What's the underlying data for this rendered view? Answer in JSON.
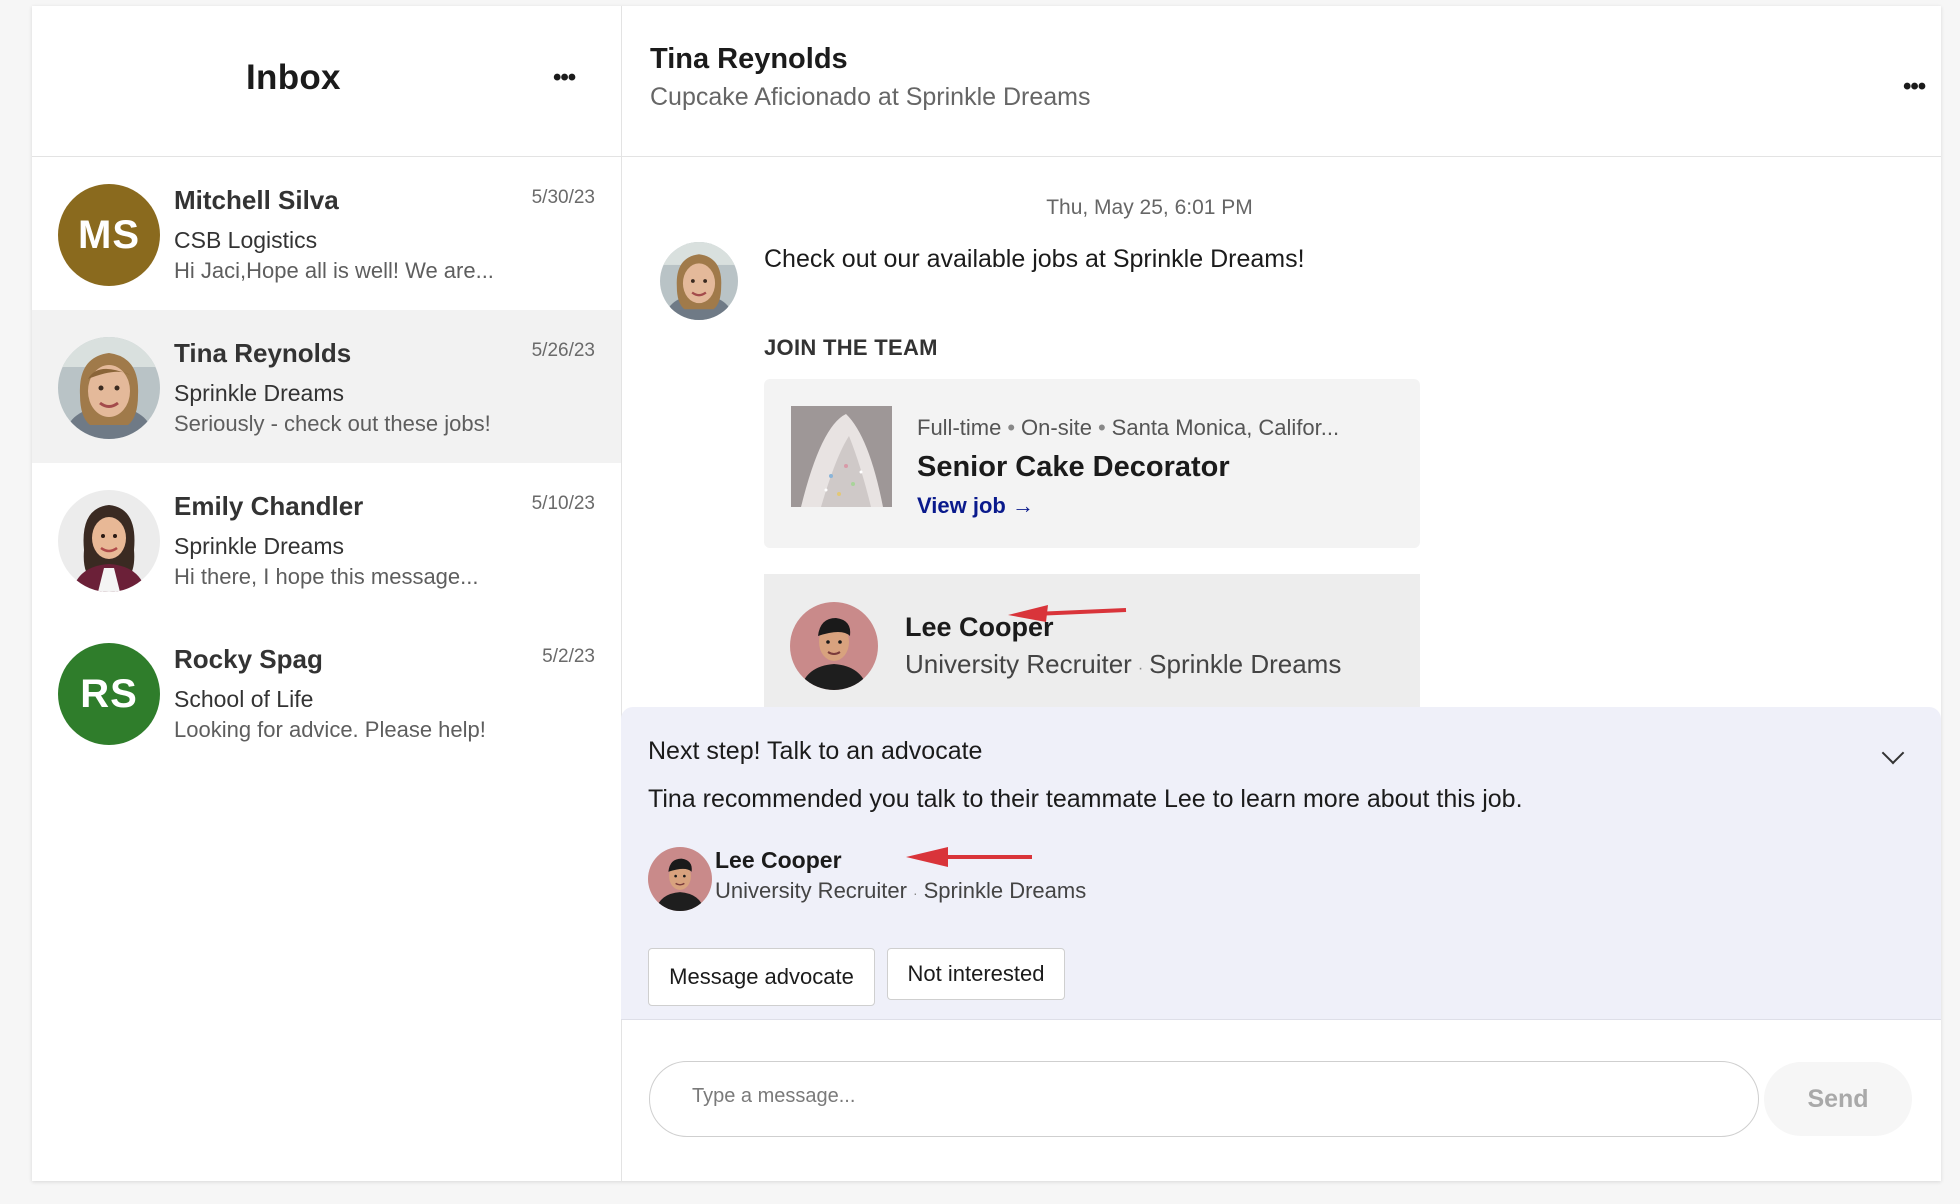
{
  "sidebar": {
    "title": "Inbox",
    "more_icon": "more-icon",
    "conversations": [
      {
        "name": "Mitchell Silva",
        "company": "CSB Logistics",
        "preview": "Hi Jaci,Hope all is well!  We are...",
        "date": "5/30/23",
        "initials": "MS",
        "avatar_color": "#8a6a1e"
      },
      {
        "name": "Tina Reynolds",
        "company": "Sprinkle Dreams",
        "preview": "Seriously - check out these jobs!",
        "date": "5/26/23",
        "active": true
      },
      {
        "name": "Emily Chandler",
        "company": "Sprinkle Dreams",
        "preview": "Hi there, I hope this message...",
        "date": "5/10/23"
      },
      {
        "name": "Rocky Spag",
        "company": "School of Life",
        "preview": "Looking for advice. Please help!",
        "date": "5/2/23",
        "initials": "RS",
        "avatar_color": "#2f7d2b"
      }
    ]
  },
  "header": {
    "name": "Tina Reynolds",
    "title": "Cupcake Aficionado at Sprinkle Dreams"
  },
  "thread": {
    "timestamp": "Thu, May 25, 6:01 PM",
    "message": "Check out our available jobs at Sprinkle Dreams!",
    "section_heading": "JOIN THE TEAM",
    "job": {
      "type": "Full-time",
      "location_type": "On-site",
      "location": "Santa Monica, Califor...",
      "title": "Senior Cake Decorator",
      "link_label": "View job →"
    },
    "recruiter": {
      "name": "Lee Cooper",
      "role": "University Recruiter",
      "company": "Sprinkle Dreams"
    }
  },
  "advocate": {
    "heading": "Next step! Talk to an advocate",
    "text": "Tina recommended you talk to their teammate Lee to learn more about this job.",
    "name": "Lee Cooper",
    "role": "University Recruiter",
    "company": "Sprinkle Dreams",
    "message_button": "Message advocate",
    "not_interested_button": "Not interested"
  },
  "compose": {
    "placeholder": "Type a message...",
    "send_label": "Send"
  },
  "colors": {
    "link": "#0a1a8c",
    "annotation_arrow": "#d9343a",
    "advocate_panel_bg": "#eff0f9"
  }
}
